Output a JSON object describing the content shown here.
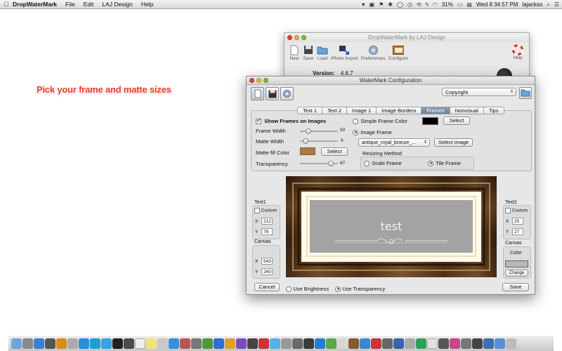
{
  "menubar": {
    "app_name": "DropWaterMark",
    "items": [
      "File",
      "Edit",
      "LAJ Design",
      "Help"
    ],
    "battery": "31%",
    "clock": "Wed 8 34 57 PM",
    "user": "lajackso"
  },
  "headline": "Pick your frame and matte sizes",
  "back_window": {
    "title": "DropWaterMark by LAJ Design",
    "toolbar": [
      "New",
      "Save",
      "Load",
      "iPhoto Import",
      "Preferences",
      "Configure"
    ],
    "help_label": "Help",
    "version_label": "Version:",
    "version_value": "4.6.7"
  },
  "window": {
    "title": "WaterMark Configuration",
    "preset_value": "Copyright",
    "tabs": [
      "Text 1",
      "Text 2",
      "Image 1",
      "Image Borders",
      "Frames",
      "Nonvisual",
      "Tips"
    ],
    "active_tab": "Frames",
    "frames": {
      "show_frames_label": "Show Frames on Images",
      "show_frames_checked": true,
      "frame_width_label": "Frame Width",
      "frame_width_value": "50",
      "frame_width_fraction": 0.18,
      "matte_width_label": "Matte Width",
      "matte_width_value": "9",
      "matte_width_fraction": 0.09,
      "matte_fill_label": "Matte fill Color",
      "matte_fill_color": "#b4773d",
      "select_label": "Select",
      "transparency_label": "Transparency",
      "transparency_value": "87",
      "transparency_fraction": 0.87,
      "simple_frame_label": "Simple Frame Color",
      "simple_frame_color": "#000000",
      "image_frame_label": "Image Frame",
      "frame_file": "antique_royal_bronze_...",
      "select_image_label": "Select image",
      "resizing_label": "Resizing Method",
      "scale_frame_label": "Scale Frame",
      "tile_frame_label": "Tile Frame",
      "tile_selected": true
    },
    "text1": {
      "header": "Text1",
      "custom_label": "Custom",
      "x_label": "X",
      "x_value": "212",
      "y_label": "Y",
      "y_value": "78"
    },
    "canvas_left": {
      "header": "Canvas",
      "x_label": "X",
      "x_value": "543",
      "y_label": "Y",
      "y_value": "260"
    },
    "text2": {
      "header": "Text2",
      "custom_label": "Custom",
      "x_label": "X",
      "x_value": "25",
      "y_label": "Y",
      "y_value": "27"
    },
    "canvas_right": {
      "header": "Canvas",
      "color_label": "Color",
      "color_value": "#b8b8b8",
      "change_label": "Change"
    },
    "preview_text": "test",
    "cancel_label": "Cancel",
    "save_label": "Save",
    "use_brightness_label": "Use Brightness",
    "use_transparency_label": "Use Transparency"
  },
  "colors": {
    "headline": "#ee3a2a",
    "frame_wood": "#5a3a1c",
    "matte": "#fffbe8",
    "preview_bg": "#a3a3a3"
  }
}
